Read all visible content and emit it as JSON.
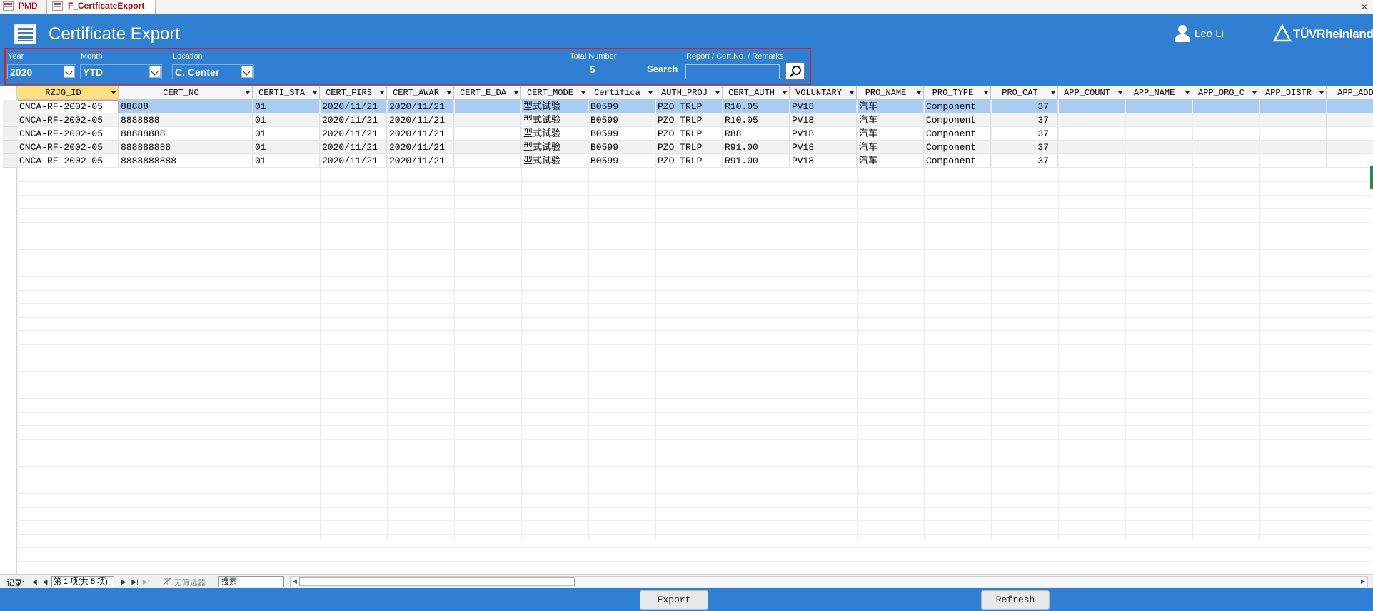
{
  "tabs": [
    {
      "label": "PMD"
    },
    {
      "label": "F_CertficateExport"
    }
  ],
  "close_glyph": "×",
  "header": {
    "title": "Certificate Export",
    "user_name": "Leo Li",
    "brand": "TÜVRheinland"
  },
  "filters": {
    "year_label": "Year",
    "year_value": "2020",
    "month_label": "Month",
    "month_value": "YTD",
    "location_label": "Location",
    "location_value": "C. Center",
    "total_label": "Total Number",
    "total_value": "5",
    "search_label": "Search",
    "search_hint": "Report / Cert.No. / Remarks",
    "search_value": ""
  },
  "columns": [
    "RZJG_ID",
    "CERT_NO",
    "CERTI_STA",
    "CERT_FIRS",
    "CERT_AWAR",
    "CERT_E_DA",
    "CERT_MODE",
    "Certifica",
    "AUTH_PROJ",
    "CERT_AUTH",
    "VOLUNTARY",
    "PRO_NAME",
    "PRO_TYPE",
    "PRO_CAT",
    "APP_COUNT",
    "APP_NAME",
    "APP_ORG_C",
    "APP_DISTR",
    "APP_ADD"
  ],
  "rows": [
    [
      "CNCA-RF-2002-05",
      "88888",
      "01",
      "2020/11/21",
      "2020/11/21",
      "",
      "型式试验",
      "B0599",
      "PZO TRLP",
      "R10.05",
      "PV18",
      "汽车",
      "Component",
      "37",
      "",
      "",
      "",
      "",
      ""
    ],
    [
      "CNCA-RF-2002-05",
      "8888888",
      "01",
      "2020/11/21",
      "2020/11/21",
      "",
      "型式试验",
      "B0599",
      "PZO TRLP",
      "R10.05",
      "PV18",
      "汽车",
      "Component",
      "37",
      "",
      "",
      "",
      "",
      ""
    ],
    [
      "CNCA-RF-2002-05",
      "88888888",
      "01",
      "2020/11/21",
      "2020/11/21",
      "",
      "型式试验",
      "B0599",
      "PZO TRLP",
      "R88",
      "PV18",
      "汽车",
      "Component",
      "37",
      "",
      "",
      "",
      "",
      ""
    ],
    [
      "CNCA-RF-2002-05",
      "888888888",
      "01",
      "2020/11/21",
      "2020/11/21",
      "",
      "型式试验",
      "B0599",
      "PZO TRLP",
      "R91.00",
      "PV18",
      "汽车",
      "Component",
      "37",
      "",
      "",
      "",
      "",
      ""
    ],
    [
      "CNCA-RF-2002-05",
      "8888888888",
      "01",
      "2020/11/21",
      "2020/11/21",
      "",
      "型式试验",
      "B0599",
      "PZO TRLP",
      "R91.00",
      "PV18",
      "汽车",
      "Component",
      "37",
      "",
      "",
      "",
      "",
      ""
    ]
  ],
  "navigation": {
    "record_label": "记录:",
    "record_position": "第 1 项(共 5 项)",
    "filter_status": "无筛选器",
    "search_text": "搜索"
  },
  "buttons": {
    "export": "Export",
    "refresh": "Refresh"
  },
  "colors": {
    "header_blue": "#2f7fd3",
    "highlight_border": "#e0182b",
    "selected_row": "#a9cdf2",
    "sorted_column": "#fce17c"
  }
}
